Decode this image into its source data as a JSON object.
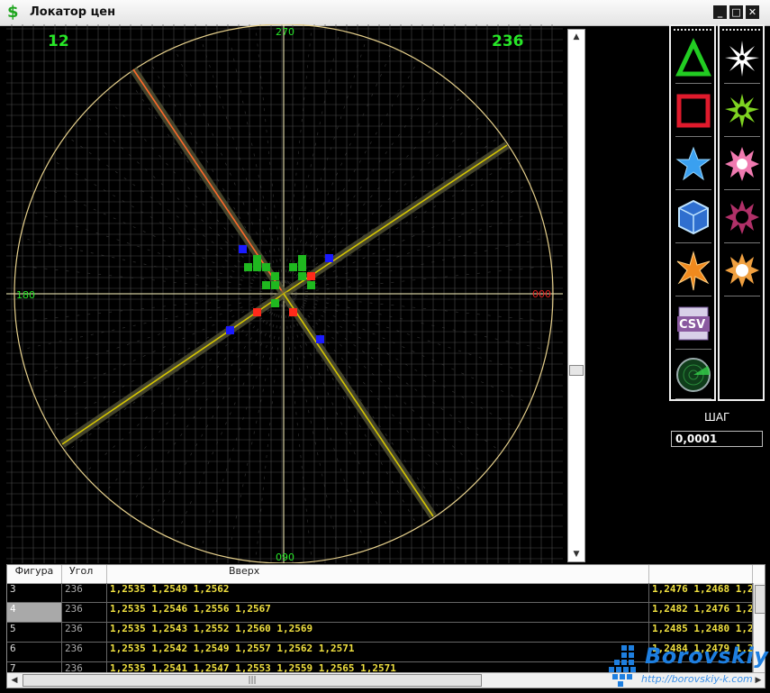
{
  "window": {
    "title": "Локатор цен",
    "icon": "dollar-icon",
    "controls": [
      "_",
      "□",
      "✕"
    ]
  },
  "radar": {
    "left_count": "12",
    "right_count": "236",
    "degree_labels": {
      "top": "270",
      "left": "180",
      "right": "000",
      "bottom": "090"
    },
    "colors": {
      "circle": "#e6d08c",
      "grid": "#4a4a4a",
      "axis": "#fff7c0",
      "counter": "#27e627",
      "degree": "#27e627",
      "degree_zero": "#e02020",
      "ray": "#d6c600",
      "ray_highlight": "#ff6a2a",
      "block_green": "#1fb81f",
      "block_red": "#ff2a1a",
      "block_blue": "#1a1aff"
    }
  },
  "palette": {
    "left_tools": [
      {
        "name": "triangle-tool"
      },
      {
        "name": "square-tool"
      },
      {
        "name": "star-tool"
      },
      {
        "name": "cube-tool"
      },
      {
        "name": "burst-tool"
      },
      {
        "name": "csv-tool",
        "label": "CSV"
      },
      {
        "name": "radar-tool"
      }
    ],
    "right_tools": [
      {
        "name": "white-star-tool"
      },
      {
        "name": "green-star-tool"
      },
      {
        "name": "pink-star-tool"
      },
      {
        "name": "dark-pink-star-tool"
      },
      {
        "name": "orange-star-tool"
      }
    ]
  },
  "step": {
    "label": "ШАГ",
    "value": "0,0001"
  },
  "table": {
    "columns": [
      "Фигура",
      "Угол",
      "Вверх",
      ""
    ],
    "rows": [
      {
        "figure": "3",
        "angle": "236",
        "up": "1,2535  1,2549  1,2562",
        "down": "1,2476  1,2468  1,2"
      },
      {
        "figure": "4",
        "angle": "236",
        "up": "1,2535  1,2546  1,2556  1,2567",
        "down": "1,2482  1,2476  1,2",
        "selected": true
      },
      {
        "figure": "5",
        "angle": "236",
        "up": "1,2535  1,2543  1,2552  1,2560  1,2569",
        "down": "1,2485  1,2480  1,2"
      },
      {
        "figure": "6",
        "angle": "236",
        "up": "1,2535  1,2542  1,2549  1,2557  1,2562  1,2571",
        "down": "1,2484  1,2479  1,2"
      },
      {
        "figure": "7",
        "angle": "236",
        "up": "1,2535  1,2541  1,2547  1,2553  1,2559  1,2565  1,2571",
        "down": ""
      }
    ]
  },
  "watermark": {
    "name": "Borovskiy",
    "url": "http://borovskiy-k.com"
  }
}
